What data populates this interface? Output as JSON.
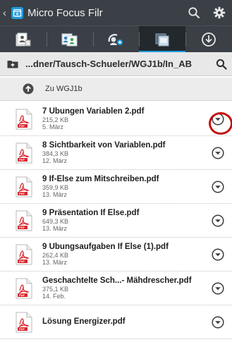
{
  "app": {
    "title": "Micro Focus Filr",
    "back_glyph": "‹",
    "icons": {
      "search": "search-icon",
      "settings": "gear-icon",
      "logo": "filr-logo"
    }
  },
  "tabs": [
    {
      "name": "tab-my-files",
      "icon": "my-files-icon"
    },
    {
      "name": "tab-shared-with-me",
      "icon": "shared-with-me-icon"
    },
    {
      "name": "tab-shared-by-me",
      "icon": "shared-by-me-icon"
    },
    {
      "name": "tab-net-folders",
      "icon": "net-folders-icon",
      "active": true
    },
    {
      "name": "tab-downloads",
      "icon": "download-icon"
    }
  ],
  "path": {
    "text": "...dner/Tausch-Schueler/WGJ1b/In_AB"
  },
  "up": {
    "label": "Zu WGJ1b"
  },
  "files": [
    {
      "name": "7 Übungen Variablen 2.pdf",
      "size": "215,2 KB",
      "date": "5. März",
      "highlighted": true
    },
    {
      "name": "8 Sichtbarkeit von Variablen.pdf",
      "size": "384,3 KB",
      "date": "12. März"
    },
    {
      "name": "9 If-Else zum Mitschreiben.pdf",
      "size": "359,9 KB",
      "date": "13. März"
    },
    {
      "name": "9 Präsentation If Else.pdf",
      "size": "649,3 KB",
      "date": "13. März"
    },
    {
      "name": "9 Übungsaufgaben If Else (1).pdf",
      "size": "262,4 KB",
      "date": "13. März"
    },
    {
      "name": "Geschachtelte Sch...- Mähdrescher.pdf",
      "size": "375,1 KB",
      "date": "14. Feb."
    },
    {
      "name": "Lösung Energizer.pdf",
      "size": "",
      "date": ""
    }
  ],
  "colors": {
    "toolbar": "#3a4046",
    "accent": "#1e9be0",
    "pdf_red": "#d8262e",
    "highlight_circle": "#c40f0f"
  },
  "pdf_badge": "PDF"
}
